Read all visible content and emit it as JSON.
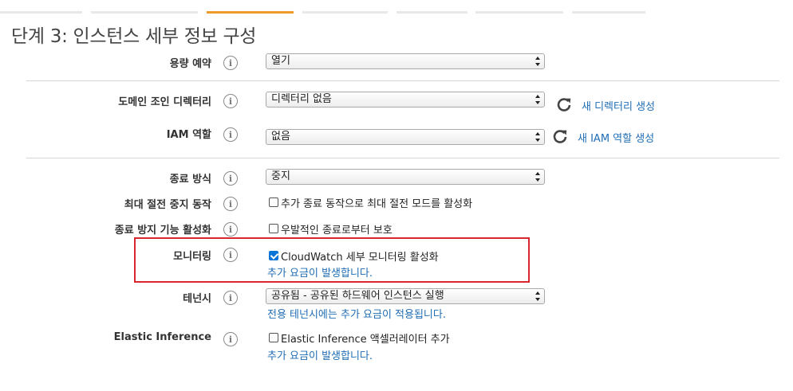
{
  "page": {
    "title": "단계 3: 인스턴스 세부 정보 구성"
  },
  "colors": {
    "accent_tab": "#ec9b2a",
    "link": "#1f6db5",
    "highlight": "#d9262e",
    "checkbox_checked": "#0b74d9"
  },
  "icons": {
    "info": "info-icon",
    "refresh": "refresh-icon",
    "select_arrows": "select-arrows-icon"
  },
  "info_glyph": "i",
  "rows": {
    "capacity_reservation": {
      "label": "용량 예약",
      "value": "열기"
    },
    "domain_join": {
      "label": "도메인 조인 디렉터리",
      "value": "디렉터리 없음",
      "create_link": "새 디렉터리 생성"
    },
    "iam_role": {
      "label": "IAM 역할",
      "value": "없음",
      "create_link": "새 IAM 역할 생성"
    },
    "shutdown_behavior": {
      "label": "종료 방식",
      "value": "중지"
    },
    "hibernation": {
      "label": "최대 절전 중지 동작",
      "checkbox_label": "추가 종료 동작으로 최대 절전 모드를 활성화",
      "checked": false
    },
    "termination_protection": {
      "label": "종료 방지 기능 활성화",
      "checkbox_label": "우발적인 종료로부터 보호",
      "checked": false
    },
    "monitoring": {
      "label": "모니터링",
      "checkbox_label": "CloudWatch 세부 모니터링 활성화",
      "checked": true,
      "note": "추가 요금이 발생합니다."
    },
    "tenancy": {
      "label": "테넌시",
      "value": "공유됨 - 공유된 하드웨어 인스턴스 실행",
      "note": "전용 테넌시에는 추가 요금이 적용됩니다."
    },
    "elastic_inference": {
      "label": "Elastic Inference",
      "checkbox_label": "Elastic Inference 액셀러레이터 추가",
      "checked": false,
      "note": "추가 요금이 발생합니다."
    }
  }
}
